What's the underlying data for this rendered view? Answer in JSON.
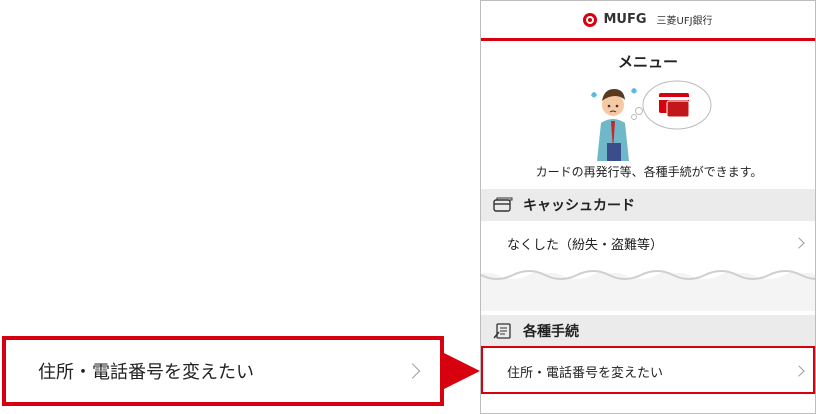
{
  "brand": {
    "logo_text": "MUFG",
    "logo_sub": "三菱UFJ銀行",
    "accent_color": "#d7000f"
  },
  "menu": {
    "title": "メニュー",
    "description": "カードの再発行等、各種手続ができます。"
  },
  "sections": [
    {
      "title": "キャッシュカード",
      "icon": "card-icon",
      "items": [
        {
          "label": "なくした（紛失・盗難等）"
        }
      ]
    },
    {
      "title": "各種手続",
      "icon": "document-pen-icon",
      "items": [
        {
          "label": "住所・電話番号を変えたい"
        }
      ]
    }
  ],
  "callout": {
    "label": "住所・電話番号を変えたい"
  }
}
